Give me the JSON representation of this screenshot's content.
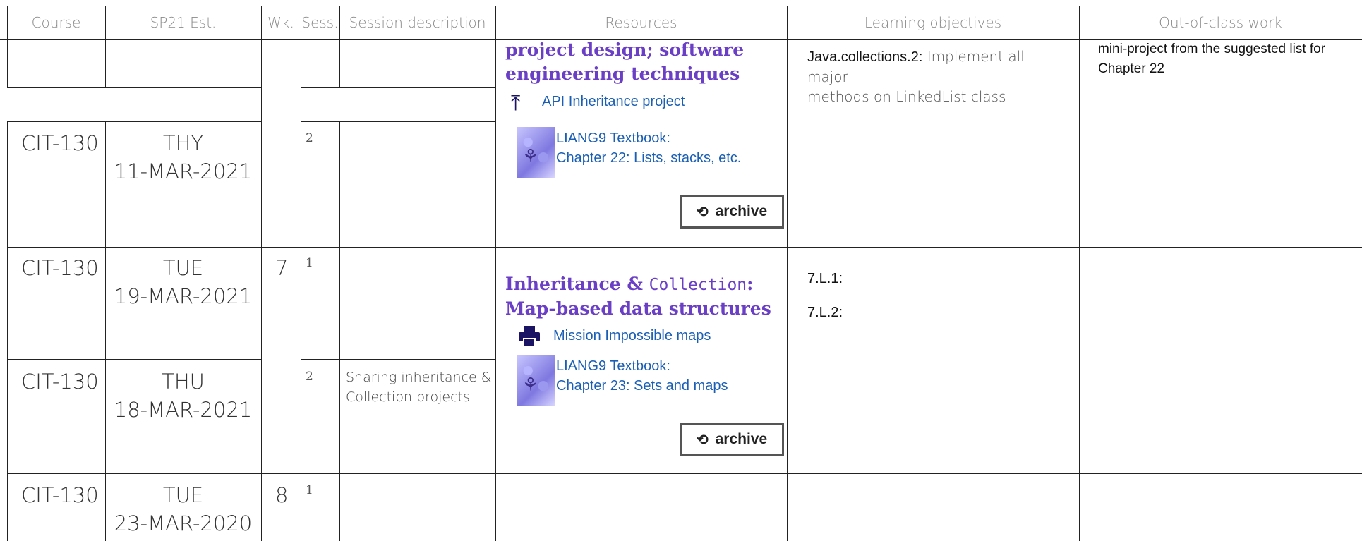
{
  "headers": {
    "course": "Course",
    "est": "SP21 Est.",
    "wk": "Wk.",
    "sess": "Sess.",
    "desc": "Session description",
    "resources": "Resources",
    "objectives": "Learning objectives",
    "outofclass": "Out-of-class work"
  },
  "rows": [
    {
      "course": "CIT-130",
      "day": "THY",
      "date": "11-MAR-2021",
      "sess": "2"
    },
    {
      "course": "CIT-130",
      "day": "TUE",
      "date": "19-MAR-2021",
      "wk": "7",
      "sess": "1"
    },
    {
      "course": "CIT-130",
      "day": "THU",
      "date": "18-MAR-2021",
      "sess": "2",
      "desc_line1": "Sharing inheritance &",
      "desc_line2": "Collection projects"
    },
    {
      "course": "CIT-130",
      "day": "TUE",
      "date": "23-MAR-2020",
      "wk": "8",
      "sess": "1"
    }
  ],
  "block1": {
    "topic_line1": "project design; software",
    "topic_line2": "engineering techniques",
    "link_api": "API Inheritance project",
    "book_title": "LIANG9 Textbook:",
    "book_chapter": "Chapter 22: Lists, stacks, etc.",
    "archive_label": "archive",
    "objective_code": "Java.collections.2:",
    "objective_text1": "Implement all major",
    "objective_text2": "methods on LinkedList class",
    "ooc_line1": "mini-project from the suggested list for",
    "ooc_line2": "Chapter 22"
  },
  "block2": {
    "topic_word1": "Inheritance &",
    "topic_code": "Collection",
    "topic_colon": ":",
    "topic_line2": "Map-based data structures",
    "link_maps": "Mission Impossible maps",
    "book_title": "LIANG9 Textbook:",
    "book_chapter": "Chapter 23: Sets and maps",
    "archive_label": "archive",
    "objective1": "7.L.1:",
    "objective2": "7.L.2:"
  },
  "icons": {
    "merge": "merge-icon",
    "print": "printer-icon",
    "history": "history-icon",
    "book": "book-cover-icon"
  },
  "colors": {
    "topic": "#6a3fc6",
    "link": "#1a5fb4",
    "icon": "#1b1464"
  }
}
